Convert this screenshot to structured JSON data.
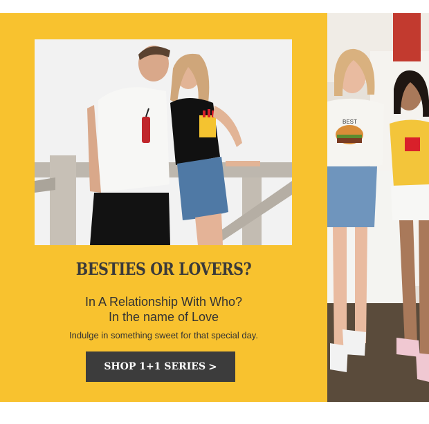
{
  "promo": {
    "headline": "BESTIES OR LOVERS?",
    "subheading_line1": "In A Relationship With Who?",
    "subheading_line2": "In the name of Love",
    "description": "Indulge in something sweet for that special day.",
    "cta_label": "SHOP 1+1 SERIES",
    "cta_icon": "chevron-right-icon"
  },
  "photo_right": {
    "shirt_text": "BEST"
  },
  "colors": {
    "banner_bg": "#f8c22f",
    "button_bg": "#3c3c3c",
    "button_text": "#ffffff",
    "headline": "#3a3a3a"
  }
}
